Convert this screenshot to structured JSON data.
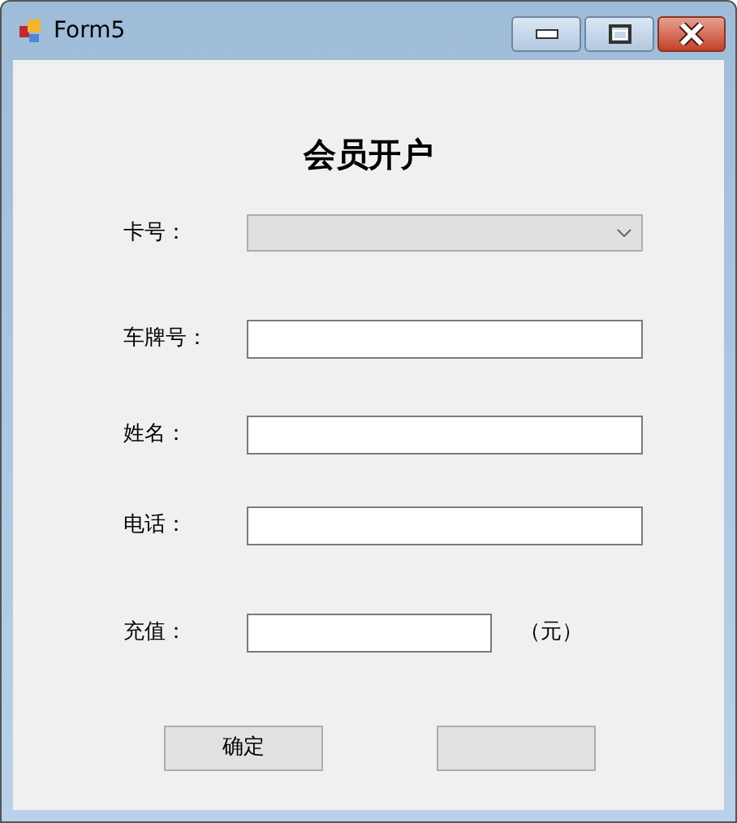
{
  "window": {
    "title": "Form5"
  },
  "heading": "会员开户",
  "fields": [
    {
      "kind": "combo",
      "label": "卡号：",
      "disabled": true
    },
    {
      "kind": "text",
      "label": "车牌号："
    },
    {
      "kind": "text",
      "label": "姓名："
    },
    {
      "kind": "text",
      "label": "电话："
    },
    {
      "kind": "short",
      "label": "充值：",
      "unit": "（元）"
    }
  ],
  "buttons": [
    {
      "kind": "labeled",
      "label": "确定"
    },
    {
      "kind": "blank"
    }
  ]
}
